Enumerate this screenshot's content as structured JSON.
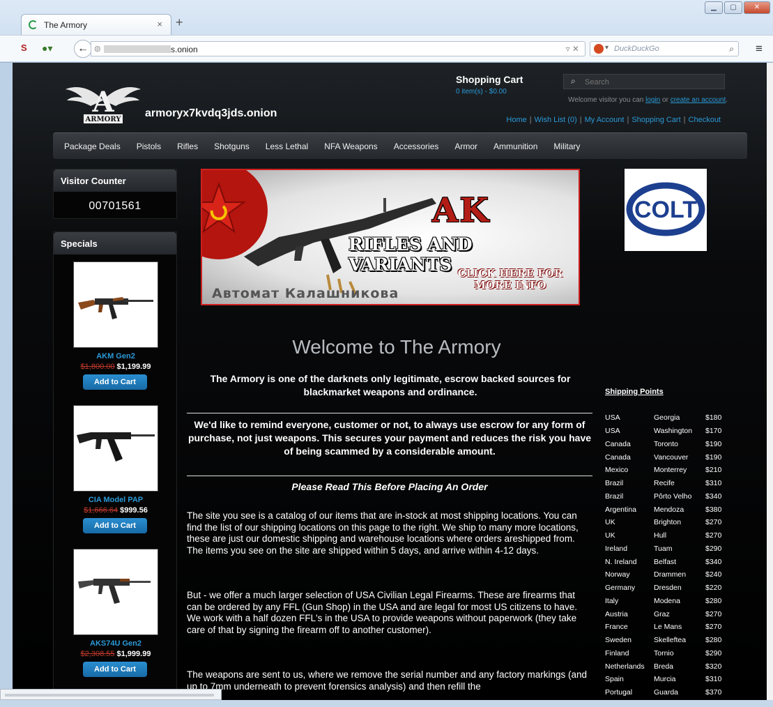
{
  "browser": {
    "tab_title": "The Armory",
    "tab_close": "×",
    "new_tab": "+",
    "url_suffix": "s.onion",
    "url_controls": "▿ ✕",
    "search_engine": "DuckDuckGo",
    "search_icon": "search-icon",
    "menu_icon": "hamburger-menu-icon"
  },
  "header": {
    "site_name": "armoryx7kvdq3jds.onion",
    "logo_text": "ARMORY",
    "cart_title": "Shopping Cart",
    "cart_count": "0 item(s) - $0.00",
    "search_placeholder": "Search",
    "welcome_prefix": "Welcome visitor you can",
    "login": "login",
    "or": "or",
    "create_account": "create an account",
    "welcome_suffix": ".",
    "links": [
      "Home",
      "Wish List (0)",
      "My Account",
      "Shopping Cart",
      "Checkout"
    ]
  },
  "categories": [
    "Package Deals",
    "Pistols",
    "Rifles",
    "Shotguns",
    "Less Lethal",
    "NFA Weapons",
    "Accessories",
    "Armor",
    "Ammunition",
    "Military"
  ],
  "visitor_counter": {
    "title": "Visitor Counter",
    "count": "00701561"
  },
  "specials": {
    "title": "Specials",
    "button_label": "Add to Cart",
    "products": [
      {
        "name": "AKM Gen2",
        "old_price": "$1,800.00",
        "price": "$1,199.99"
      },
      {
        "name": "CIA Model PAP",
        "old_price": "$1,666.64",
        "price": "$999.56"
      },
      {
        "name": "AKS74U Gen2",
        "old_price": "$2,308.55",
        "price": "$1,999.99"
      }
    ]
  },
  "banner": {
    "title": "AK",
    "subtitle": "RIFLES AND VARIANTS",
    "cta_line1": "CLICK HERE FOR",
    "cta_line2": "MORE INFO",
    "russian": "Автомат Калашникова"
  },
  "colt_logo_text": "COLT",
  "colors": {
    "accent_link": "#2a9ad8",
    "button": "#1f7dbd",
    "banner_border": "#cf2020",
    "old_price": "#c0392b"
  },
  "main": {
    "welcome_title": "Welcome to The Armory",
    "intro": "The Armory is one of the darknets only legitimate, escrow backed sources for blackmarket weapons and ordinance.",
    "remind": "We'd like to remind everyone, customer or not, to always use escrow for any form of purchase, not just weapons. This secures your payment and reduces the risk you have of being scammed by a considerable amount.",
    "read_title": "Please Read This Before Placing An Order",
    "p1": "The site you see is a catalog of our items that are in-stock at most shipping locations. You can find the list of our shipping locations on this page to the right. We ship to many more locations, these are just our domestic shipping and warehouse locations where orders areshipped from. The items you see on the site are shipped within 5 days, and arrive within 4-12 days.",
    "p2": "But - we offer a much larger selection of USA Civilian Legal Firearms. These are firearms that can be ordered by any FFL (Gun Shop) in the USA and are legal for most US citizens to have. We work with a half dozen FFL's in the USA to provide weapons without paperwork (they take care of that by signing the firearm off to another customer).",
    "p3": "The weapons are sent to us, where we remove the serial number and any factory markings (and up to 7mm underneath to prevent forensics analysis) and then refill the"
  },
  "shipping": {
    "title": "Shipping Points",
    "rows": [
      [
        "USA",
        "Georgia",
        "$180"
      ],
      [
        "USA",
        "Washington",
        "$170"
      ],
      [
        "Canada",
        "Toronto",
        "$190"
      ],
      [
        "Canada",
        "Vancouver",
        "$190"
      ],
      [
        "Mexico",
        "Monterrey",
        "$210"
      ],
      [
        "Brazil",
        "Recife",
        "$310"
      ],
      [
        "Brazil",
        "Pôrto Velho",
        "$340"
      ],
      [
        "Argentina",
        "Mendoza",
        "$380"
      ],
      [
        "UK",
        "Brighton",
        "$270"
      ],
      [
        "UK",
        "Hull",
        "$270"
      ],
      [
        "Ireland",
        "Tuam",
        "$290"
      ],
      [
        "N. Ireland",
        "Belfast",
        "$340"
      ],
      [
        "Norway",
        "Drammen",
        "$240"
      ],
      [
        "Germany",
        "Dresden",
        "$220"
      ],
      [
        "Italy",
        "Modena",
        "$280"
      ],
      [
        "Austria",
        "Graz",
        "$270"
      ],
      [
        "France",
        "Le Mans",
        "$270"
      ],
      [
        "Sweden",
        "Skelleftea",
        "$280"
      ],
      [
        "Finland",
        "Tornio",
        "$290"
      ],
      [
        "Netherlands",
        "Breda",
        "$320"
      ],
      [
        "Spain",
        "Murcia",
        "$310"
      ],
      [
        "Portugal",
        "Guarda",
        "$370"
      ]
    ]
  }
}
